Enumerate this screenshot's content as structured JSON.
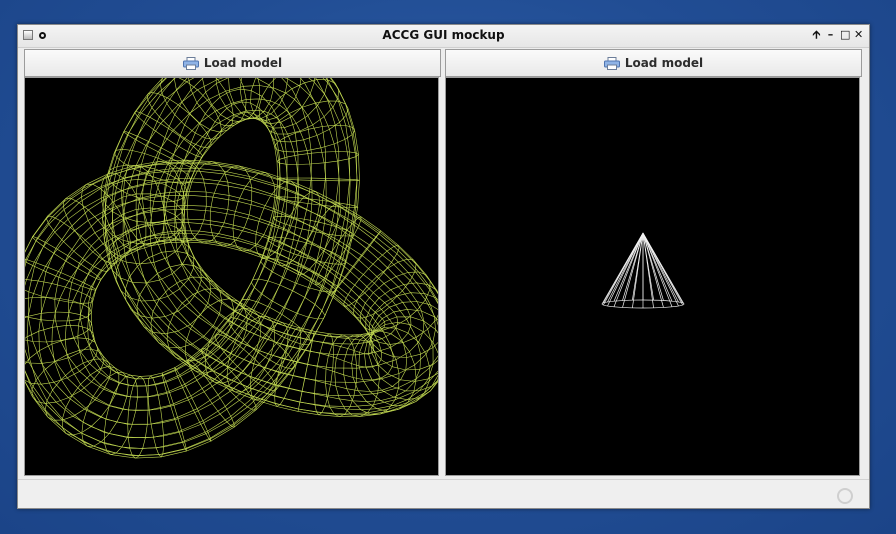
{
  "window": {
    "title": "ACCG GUI mockup",
    "controls": {
      "pin_icon": "arrow-up-icon",
      "minimize_icon": "minimize-icon",
      "maximize_icon": "maximize-icon",
      "close_icon": "close-icon",
      "pin_glyph": "🡩",
      "minimize_glyph": "–",
      "maximize_glyph": "□",
      "close_glyph": "✕"
    }
  },
  "panes": [
    {
      "button_label": "Load model",
      "button_icon": "printer-icon",
      "model": "wireframe-knot",
      "wire_color": "#d6f05a"
    },
    {
      "button_label": "Load model",
      "button_icon": "printer-icon",
      "model": "wireframe-cone",
      "wire_color": "#f2f2f2"
    }
  ],
  "colors": {
    "desktop": "#2a589f",
    "viewport_bg": "#000000"
  },
  "statusbar": {
    "indicator": "busy-indicator-icon"
  }
}
